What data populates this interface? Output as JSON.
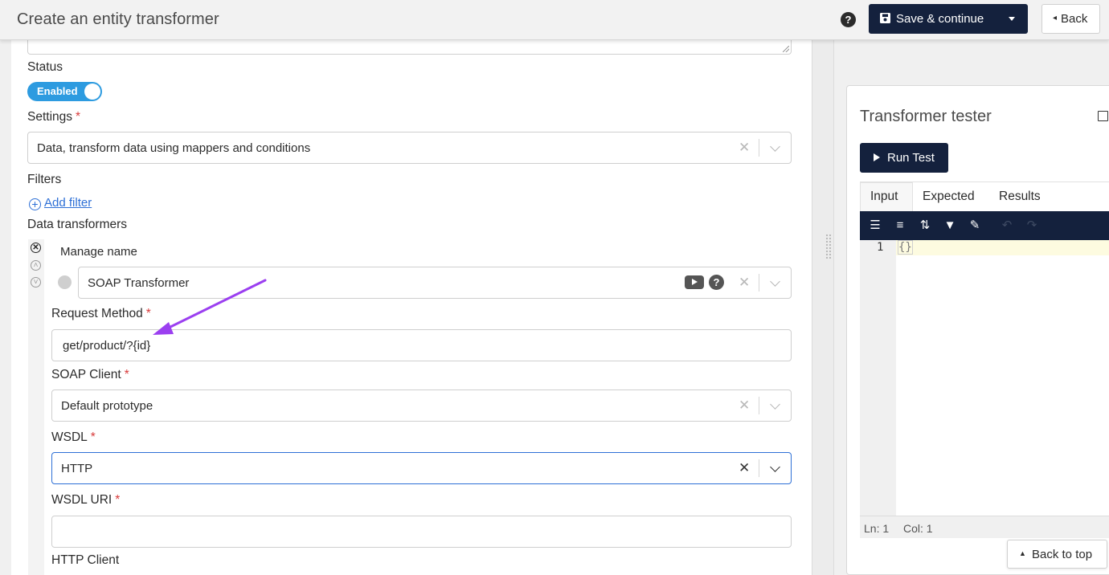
{
  "header": {
    "title": "Create an entity transformer",
    "save_label": "Save & continue",
    "back_label": "Back"
  },
  "form": {
    "status": {
      "label": "Status",
      "toggle_label": "Enabled",
      "enabled": true
    },
    "settings": {
      "label": "Settings",
      "required_mark": "*",
      "value": "Data, transform data using mappers and conditions"
    },
    "filters": {
      "label": "Filters",
      "add_label": "Add filter"
    },
    "data_transformers": {
      "label": "Data transformers",
      "manage_name_label": "Manage name",
      "transformer_value": "SOAP Transformer"
    },
    "request_method": {
      "label": "Request Method",
      "required_mark": "*",
      "value": "get/product/?{id}"
    },
    "soap_client": {
      "label": "SOAP Client",
      "required_mark": "*",
      "value": "Default prototype"
    },
    "wsdl": {
      "label": "WSDL",
      "required_mark": "*",
      "value": "HTTP"
    },
    "wsdl_uri": {
      "label": "WSDL URI",
      "required_mark": "*",
      "value": ""
    },
    "http_client": {
      "label": "HTTP Client"
    }
  },
  "tester": {
    "title": "Transformer tester",
    "run_label": "Run Test",
    "tabs": [
      "Input",
      "Expected",
      "Results"
    ],
    "active_tab": "Input",
    "line_number": "1",
    "code": "{}",
    "status_ln": "Ln: 1",
    "status_col": "Col: 1"
  },
  "back_to_top_label": "Back to top",
  "colors": {
    "primary_dark": "#14213d",
    "toggle_blue": "#2d9be0",
    "link_blue": "#2d6fd6",
    "required_red": "#d83a3a",
    "annotation_arrow": "#9b3ff0"
  }
}
